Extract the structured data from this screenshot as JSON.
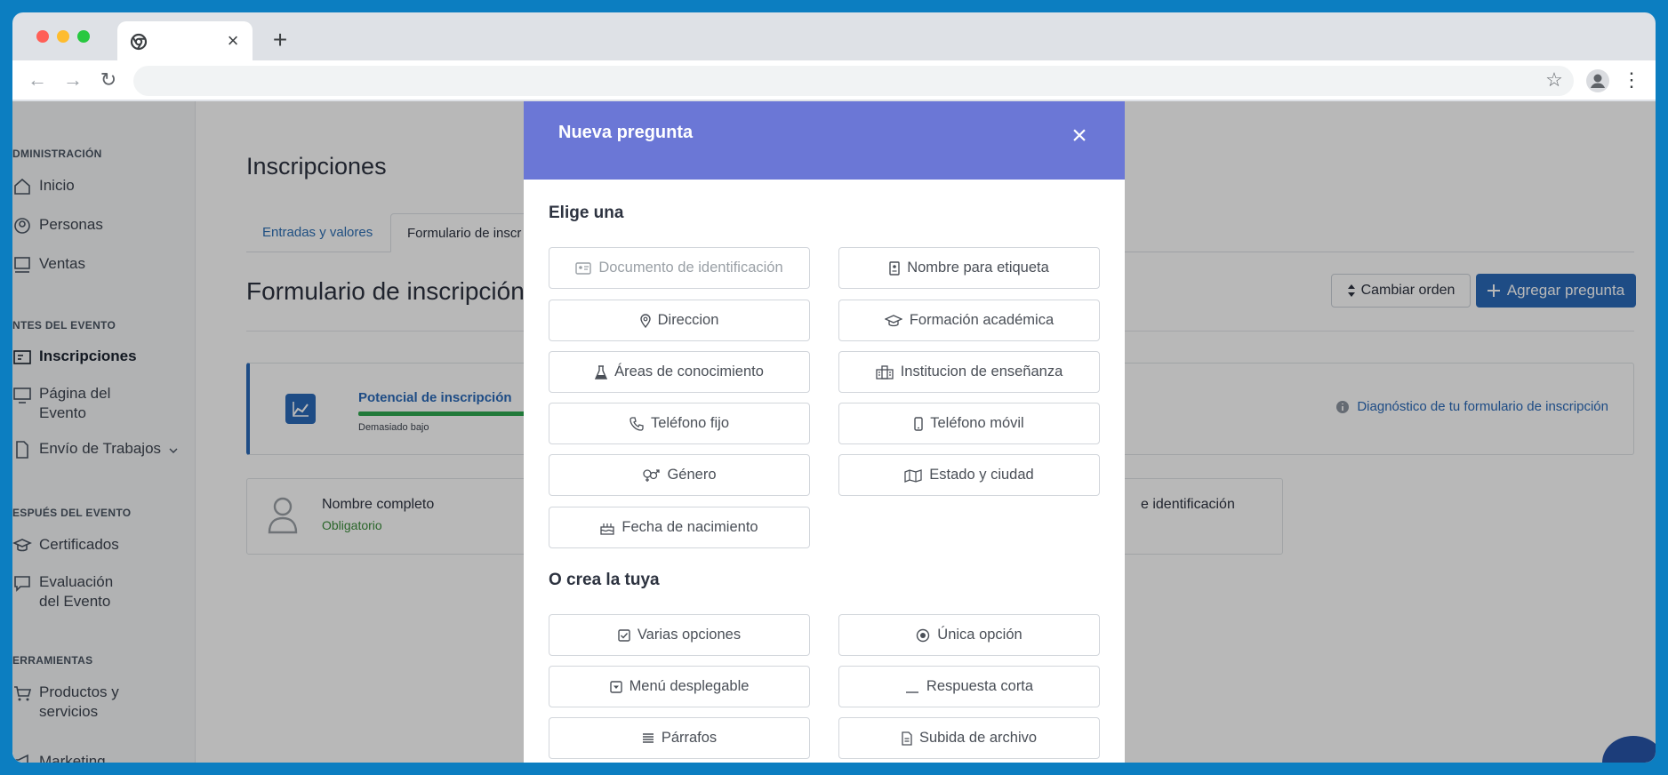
{
  "browser": {
    "tab_close": "×",
    "new_tab": "+",
    "back": "←",
    "forward": "→",
    "reload": "↻",
    "bookmark": "☆",
    "menu": "⋮"
  },
  "sidebar": {
    "sections": [
      {
        "label": "DMINISTRACIÓN"
      },
      {
        "label": "NTES DEL EVENTO"
      },
      {
        "label": "ESPUÉS DEL EVENTO"
      },
      {
        "label": "ERRAMIENTAS"
      }
    ],
    "items": [
      {
        "label": "Inicio",
        "icon": "home-icon"
      },
      {
        "label": "Personas",
        "icon": "person-icon"
      },
      {
        "label": "Ventas",
        "icon": "register-icon"
      },
      {
        "label": "Inscripciones",
        "icon": "form-icon"
      },
      {
        "label": "Página del Evento",
        "icon": "monitor-icon"
      },
      {
        "label": "Envío de Trabajos",
        "icon": "document-icon"
      },
      {
        "label": "Certificados",
        "icon": "certificate-icon"
      },
      {
        "label": "Evaluación del Evento",
        "icon": "chat-icon"
      },
      {
        "label": "Productos y servicios",
        "icon": "cart-icon"
      },
      {
        "label": "Marketing",
        "icon": "megaphone-icon"
      }
    ]
  },
  "page": {
    "title": "Inscripciones",
    "tabs": [
      {
        "label": "Entradas y valores"
      },
      {
        "label": "Formulario de inscr"
      }
    ],
    "form_title": "Formulario de inscripción",
    "change_order": "Cambiar orden",
    "add_question": "Agregar pregunta",
    "potential_label": "Potencial de inscripción",
    "potential_status": "Demasiado bajo",
    "diagnostic_link": "Diagnóstico de tu formulario de inscripción",
    "field_name": "Nombre completo",
    "field_required": "Obligatorio",
    "field_name_2": "e identificación"
  },
  "modal": {
    "title": "Nueva pregunta",
    "close": "×",
    "section_choose": "Elige una",
    "section_create": "O crea la tuya",
    "preset_questions": [
      {
        "label": "Documento de identificación",
        "icon": "id-card-icon",
        "disabled": true
      },
      {
        "label": "Nombre para etiqueta",
        "icon": "badge-icon"
      },
      {
        "label": "Direccion",
        "icon": "location-pin-icon"
      },
      {
        "label": "Formación académica",
        "icon": "graduation-cap-icon"
      },
      {
        "label": "Áreas de conocimiento",
        "icon": "flask-icon"
      },
      {
        "label": "Institucion de enseñanza",
        "icon": "school-icon"
      },
      {
        "label": "Teléfono fijo",
        "icon": "phone-icon"
      },
      {
        "label": "Teléfono móvil",
        "icon": "mobile-icon"
      },
      {
        "label": "Género",
        "icon": "gender-icon"
      },
      {
        "label": "Estado y ciudad",
        "icon": "map-icon"
      },
      {
        "label": "Fecha de nacimiento",
        "icon": "cake-icon"
      }
    ],
    "custom_questions": [
      {
        "label": "Varias opciones",
        "icon": "checkbox-icon"
      },
      {
        "label": "Única opción",
        "icon": "radio-icon"
      },
      {
        "label": "Menú desplegable",
        "icon": "dropdown-icon"
      },
      {
        "label": "Respuesta corta",
        "icon": "short-answer-icon"
      },
      {
        "label": "Párrafos",
        "icon": "paragraph-icon"
      },
      {
        "label": "Subida de archivo",
        "icon": "file-upload-icon"
      }
    ]
  }
}
